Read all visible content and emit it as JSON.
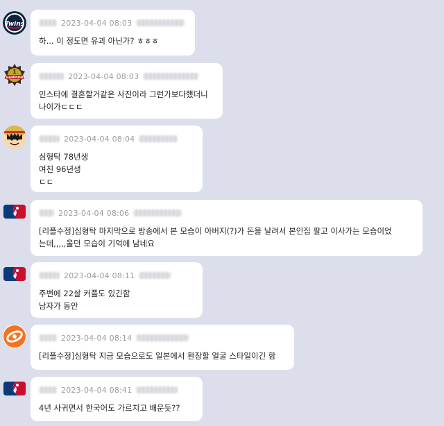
{
  "messages": [
    {
      "time": "2023-04-04 08:03",
      "text": "하... 이 정도면 유괴 아닌가? ㅎㅎㅎ",
      "avatar": "twins-logo-icon"
    },
    {
      "time": "2023-04-04 08:03",
      "text": "인스타에 결혼할거같은 사진이라 그런가보다했더니\n나이가ㄷㄷㄷ",
      "avatar": "champions-badge-icon"
    },
    {
      "time": "2023-04-04 08:04",
      "text": "심형탁 78년생\n여친 96년생\nㄷㄷ",
      "avatar": "luffy-avatar-icon"
    },
    {
      "time": "2023-04-04 08:06",
      "text": "[리플수정]심형탁 마지막으로 방송에서 본 모습이 아버지(?)가 돈을 날려서 본인집 팔고 이사가는 모습이었\n는데,,,,,울던 모습이 기억에 남네요",
      "avatar": "mlb-logo-icon"
    },
    {
      "time": "2023-04-04 08:11",
      "text": "주변에 22살 커플도 있긴함\n남자가 동안",
      "avatar": "mlb-logo-icon"
    },
    {
      "time": "2023-04-04 08:14",
      "text": "[리플수정]심형탁 지금 모습으로도 일본에서 환장할 얼굴 스타일이긴 함",
      "avatar": "hanwha-logo-icon"
    },
    {
      "time": "2023-04-04 08:41",
      "text": "4년 사귀면서 한국어도 가르치고 배운듯??",
      "avatar": "mlb-logo-icon"
    }
  ],
  "colors": {
    "background": "#dcdfeb",
    "bubble": "#ffffff",
    "time": "#9a9aa3",
    "text": "#222222"
  }
}
